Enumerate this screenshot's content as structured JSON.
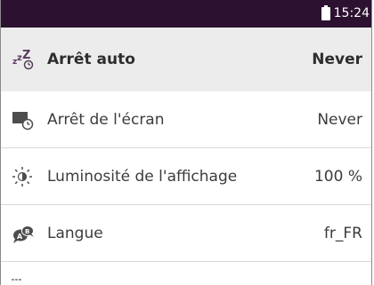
{
  "status_bar": {
    "time": "15:24",
    "background": "#2c1230"
  },
  "header_row": {
    "label": "Arrêt auto",
    "value": "Never",
    "icon": "sleep-zzz-icon"
  },
  "rows": [
    {
      "label": "Arrêt de l'écran",
      "value": "Never",
      "icon": "screen-timer-icon"
    },
    {
      "label": "Luminosité de l'affichage",
      "value": "100 %",
      "icon": "brightness-icon"
    },
    {
      "label": "Langue",
      "value": "fr_FR",
      "icon": "language-icon"
    }
  ]
}
